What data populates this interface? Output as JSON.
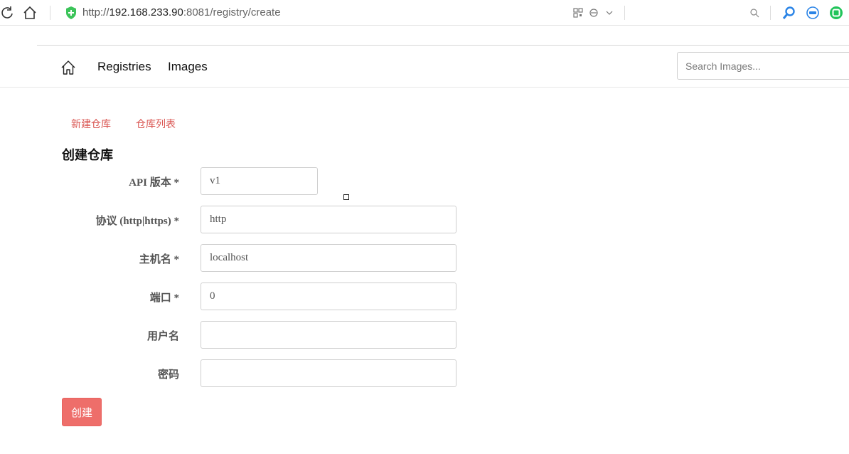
{
  "browser": {
    "url_scheme": "http://",
    "url_host": "192.168.233.90",
    "url_rest": ":8081/registry/create"
  },
  "navbar": {
    "links": [
      "Registries",
      "Images"
    ],
    "search_placeholder": "Search Images..."
  },
  "subnav": {
    "new_label": "新建仓库",
    "list_label": "仓库列表"
  },
  "form": {
    "title": "创建仓库",
    "fields": [
      {
        "label": "API 版本 *",
        "value": "v1"
      },
      {
        "label": "协议 (http|https) *",
        "value": "http"
      },
      {
        "label": "主机名 *",
        "value": "localhost"
      },
      {
        "label": "端口 *",
        "value": "0"
      },
      {
        "label": "用户名",
        "value": ""
      },
      {
        "label": "密码",
        "value": ""
      }
    ],
    "submit_label": "创建"
  },
  "colors": {
    "accent": "#d9534f",
    "button": "#ee6e6a",
    "shield": "#3cc45a",
    "browser_blue": "#2b84e6",
    "browser_green": "#21c45a"
  }
}
